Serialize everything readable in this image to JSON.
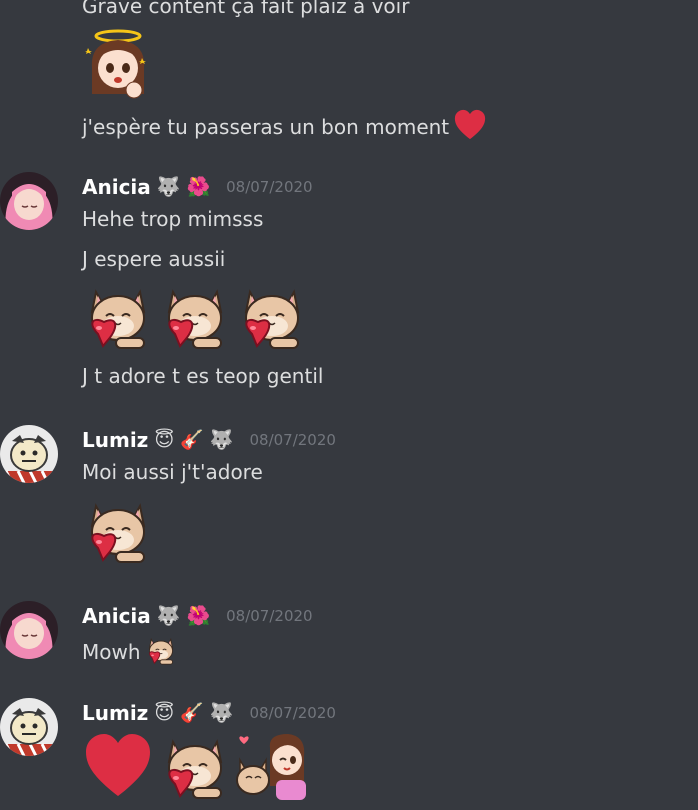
{
  "messages": [
    {
      "lines": [
        "Grave content ça fait plaiz à voir",
        "j'espère tu passeras un bon moment"
      ],
      "emotes": [
        "angel-girl-emote",
        "heart-emoji"
      ]
    },
    {
      "author": "Anicia",
      "badges": [
        "🐺",
        "🌺"
      ],
      "timestamp": "08/07/2020",
      "lines": [
        "Hehe trop mimsss",
        "J espere aussii",
        "J t adore t es teop gentil"
      ],
      "emotes": [
        "cat-heart-emote",
        "cat-heart-emote",
        "cat-heart-emote"
      ]
    },
    {
      "author": "Lumiz",
      "badges": [
        "😇",
        "🎸",
        "🐺"
      ],
      "timestamp": "08/07/2020",
      "lines": [
        "Moi aussi j't'adore"
      ],
      "emotes": [
        "cat-heart-emote"
      ]
    },
    {
      "author": "Anicia",
      "badges": [
        "🐺",
        "🌺"
      ],
      "timestamp": "08/07/2020",
      "lines": [
        "Mowh"
      ],
      "emotes": [
        "cat-heart-emote"
      ]
    },
    {
      "author": "Lumiz",
      "badges": [
        "😇",
        "🎸",
        "🐺"
      ],
      "timestamp": "08/07/2020",
      "lines": [],
      "emotes": [
        "heart-emoji",
        "cat-heart-emote",
        "girl-cat-hug-emote"
      ]
    }
  ],
  "colors": {
    "background": "#36393f",
    "text": "#dcddde",
    "username": "#ffffff",
    "timestamp": "#72767d",
    "heart": "#dd2e44"
  }
}
